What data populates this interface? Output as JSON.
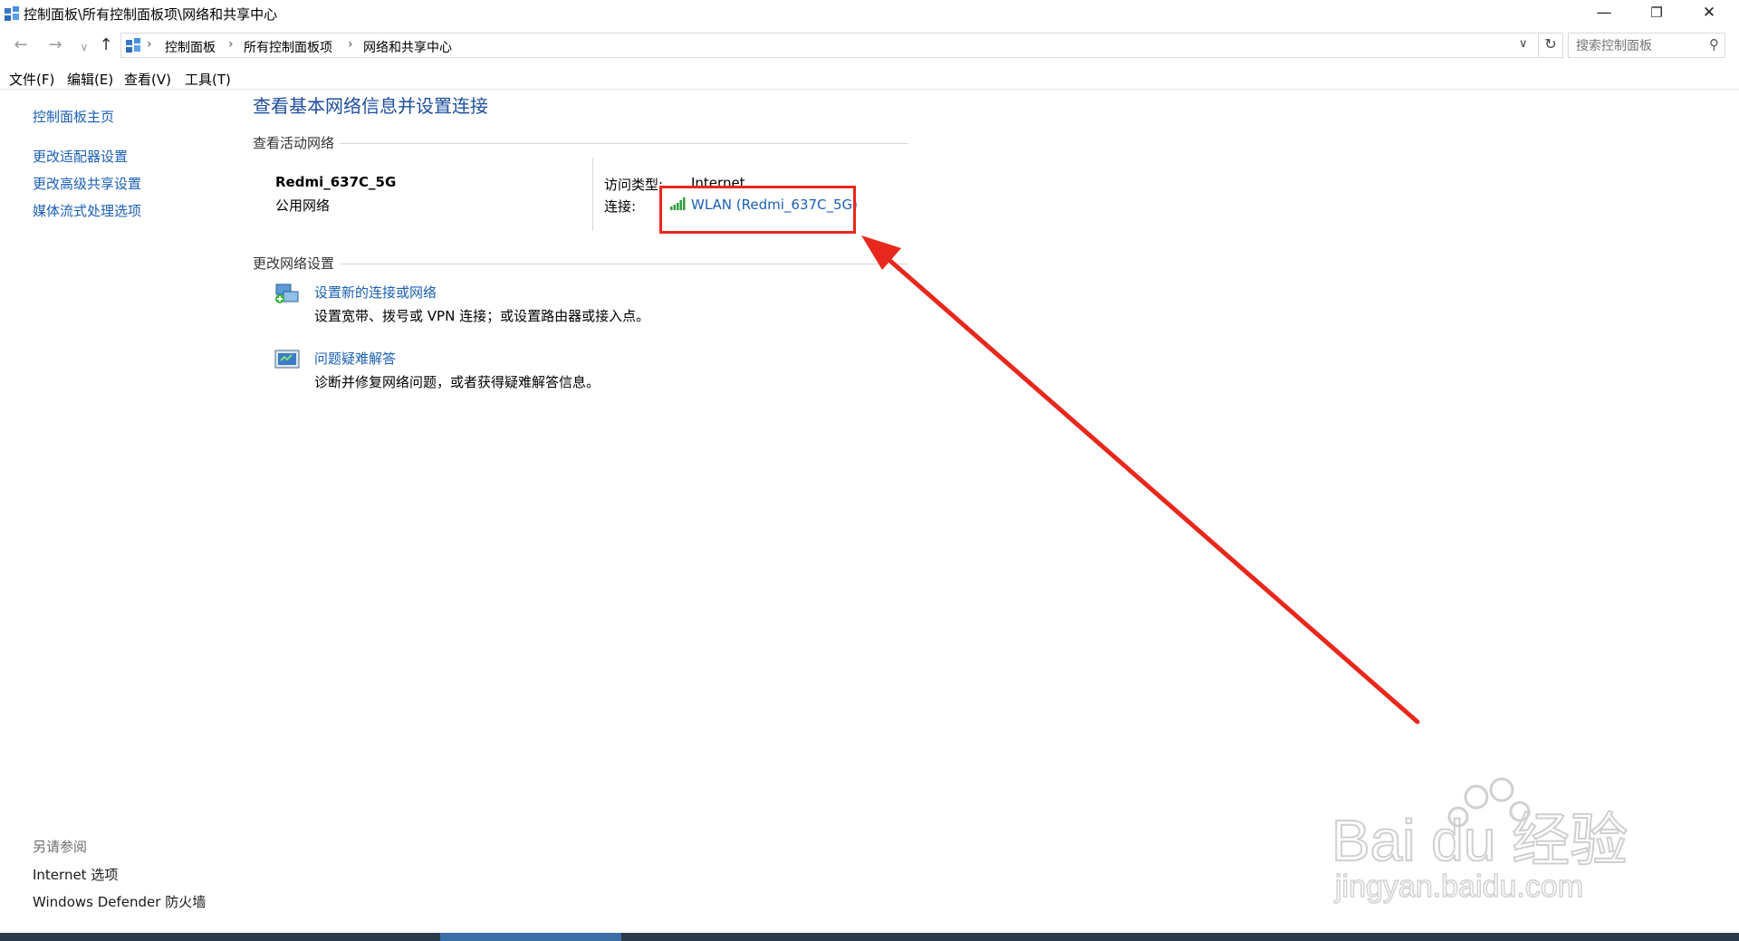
{
  "window": {
    "title": "控制面板\\所有控制面板项\\网络和共享中心",
    "minimize_glyph": "—",
    "maximize_glyph": "❐",
    "close_glyph": "✕"
  },
  "address": {
    "back_glyph": "←",
    "forward_glyph": "→",
    "recent_glyph": "∨",
    "up_glyph": "↑",
    "breadcrumbs": [
      "控制面板",
      "所有控制面板项",
      "网络和共享中心"
    ],
    "separator": "›",
    "dropdown_glyph": "∨",
    "refresh_glyph": "↻",
    "search_placeholder": "搜索控制面板",
    "search_glyph": "⚲"
  },
  "menu": [
    "文件(F)",
    "编辑(E)",
    "查看(V)",
    "工具(T)"
  ],
  "sidebar": {
    "home": "控制面板主页",
    "links": [
      "更改适配器设置",
      "更改高级共享设置",
      "媒体流式处理选项"
    ],
    "see_also_title": "另请参阅",
    "see_also": [
      "Internet 选项",
      "Windows Defender 防火墙"
    ]
  },
  "main": {
    "title": "查看基本网络信息并设置连接",
    "active_section": "查看活动网络",
    "network_name": "Redmi_637C_5G",
    "network_type": "公用网络",
    "access_label": "访问类型:",
    "access_value": "Internet",
    "connection_label": "连接:",
    "connection_link": "WLAN (Redmi_637C_5G)",
    "change_section": "更改网络设置",
    "tasks": [
      {
        "title": "设置新的连接或网络",
        "desc": "设置宽带、拨号或 VPN 连接；或设置路由器或接入点。",
        "icon": "network-setup-icon"
      },
      {
        "title": "问题疑难解答",
        "desc": "诊断并修复网络问题，或者获得疑难解答信息。",
        "icon": "troubleshoot-icon"
      }
    ]
  },
  "watermark": {
    "logo": "Bai du 经验",
    "url": "jingyan.baidu.com"
  },
  "colors": {
    "link": "#1a5fb4",
    "title_blue": "#1e4e9c",
    "annotation_red": "#e8281c"
  }
}
